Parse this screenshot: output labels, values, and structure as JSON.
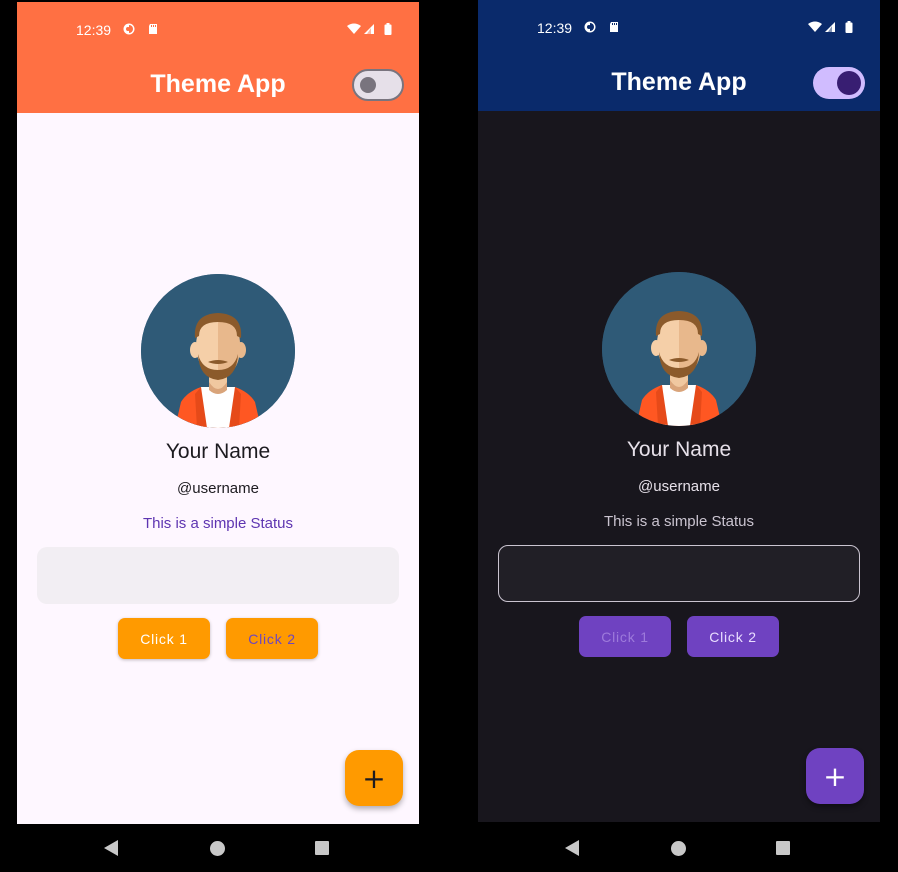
{
  "screens": [
    {
      "theme": "light",
      "status_bar": {
        "time": "12:39"
      },
      "app_bar": {
        "title": "Theme App",
        "dark_mode_toggle": false
      },
      "profile": {
        "name": "Your Name",
        "username": "@username",
        "status": "This is a simple Status"
      },
      "text_field": {
        "value": "",
        "placeholder": ""
      },
      "buttons": {
        "click1_label": "Click 1",
        "click2_label": "Click 2"
      },
      "fab": {
        "label": "+"
      },
      "colors": {
        "app_bar": "#FF7043",
        "background": "#FEF7FF",
        "button": "#FF9A00",
        "status_text": "#5E35B1"
      }
    },
    {
      "theme": "dark",
      "status_bar": {
        "time": "12:39"
      },
      "app_bar": {
        "title": "Theme App",
        "dark_mode_toggle": true
      },
      "profile": {
        "name": "Your Name",
        "username": "@username",
        "status": "This is a simple Status"
      },
      "text_field": {
        "value": "",
        "placeholder": ""
      },
      "buttons": {
        "click1_label": "Click 1",
        "click2_label": "Click 2"
      },
      "fab": {
        "label": "+"
      },
      "colors": {
        "app_bar": "#0A2A6B",
        "background": "#18161D",
        "button": "#6F42C1",
        "status_text": "#CAC4D0"
      }
    }
  ],
  "icons": {
    "status_bar": [
      "notification-icon",
      "sd-card-icon",
      "wifi-icon",
      "signal-icon",
      "battery-icon"
    ],
    "nav_bar": [
      "back-icon",
      "home-icon",
      "recents-icon"
    ],
    "fab": "plus-icon",
    "avatar": "person-avatar-icon"
  }
}
